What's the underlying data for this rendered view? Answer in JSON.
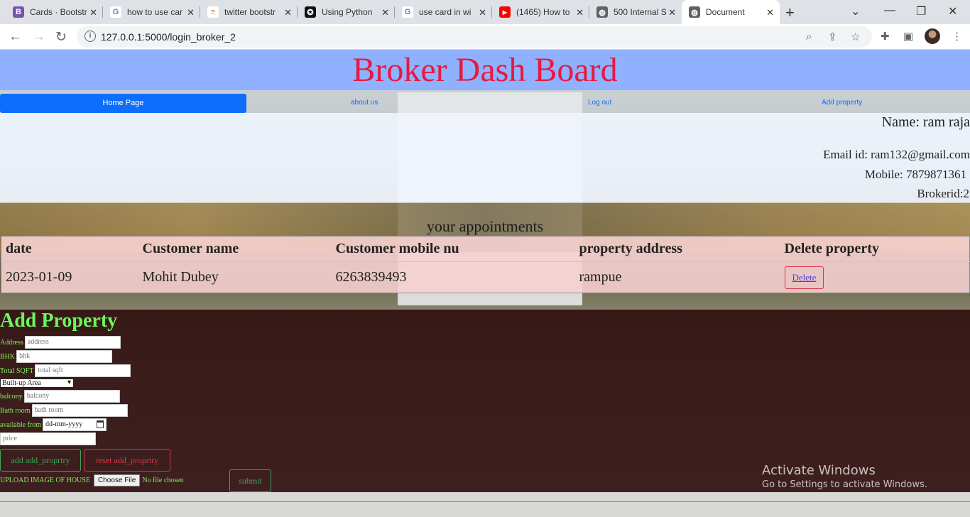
{
  "browser": {
    "tabs": [
      {
        "title": "Cards · Bootstr",
        "icon": "bootstrap-icon",
        "color": "#7952b3",
        "glyph": "B"
      },
      {
        "title": "how to use car",
        "icon": "google-icon",
        "color": "#4285f4",
        "glyph": "G"
      },
      {
        "title": "twitter bootstr",
        "icon": "stackoverflow-icon",
        "color": "#f48024",
        "glyph": "≡"
      },
      {
        "title": "Using Python",
        "icon": "github-icon",
        "color": "#111111",
        "glyph": "✪"
      },
      {
        "title": "use card in wi",
        "icon": "google-icon",
        "color": "#4285f4",
        "glyph": "G"
      },
      {
        "title": "(1465) How to",
        "icon": "youtube-icon",
        "color": "#ff0000",
        "glyph": "▶"
      },
      {
        "title": "500 Internal S",
        "icon": "globe-icon",
        "color": "#5f6368",
        "glyph": "◍"
      },
      {
        "title": "Document",
        "icon": "globe-icon",
        "color": "#5f6368",
        "glyph": "◍"
      }
    ],
    "url": "127.0.0.1:5000/login_broker_2"
  },
  "header": {
    "title": "Broker Dash Board"
  },
  "nav": {
    "home": "Home Page",
    "about": "about us",
    "logout": "Log out",
    "add": "Add property"
  },
  "profile": {
    "name": "Name: ram raja",
    "email": "Email id: ram132@gmail.com",
    "mobile": "Mobile: 7879871361",
    "brokerid": "Brokerid:2"
  },
  "appointments": {
    "title": "your appointments",
    "columns": [
      "date",
      "Customer name",
      "Customer mobile nu",
      "property address",
      "Delete property"
    ],
    "rows": [
      {
        "date": "2023-01-09",
        "customer": "Mohit Dubey",
        "mobile": "6263839493",
        "address": "rampue",
        "action": "Delete"
      }
    ]
  },
  "add_property": {
    "title": "Add Property",
    "address_label": "Address",
    "address_ph": "address",
    "bhk_label": "BHK",
    "bhk_ph": "bhk",
    "sqft_label": "Total SQFT",
    "sqft_ph": "total sqft",
    "area_type": "Built-up Area",
    "balcony_label": "balcony",
    "balcony_ph": "balcony",
    "bath_label": "Bath room",
    "bath_ph": "bath room",
    "avail_label": "available from",
    "avail_ph": "dd-mm-yyyy",
    "price_ph": "price",
    "add_btn": "add add_proprtry",
    "reset_btn": "reset add_proprtry",
    "upload_label": "UPLOAD IMAGE OF HOUSE",
    "choose_file": "Choose File",
    "no_file": "No file chosen",
    "submit": "submit"
  },
  "watermark": {
    "line1": "Activate Windows",
    "line2": "Go to Settings to activate Windows."
  }
}
